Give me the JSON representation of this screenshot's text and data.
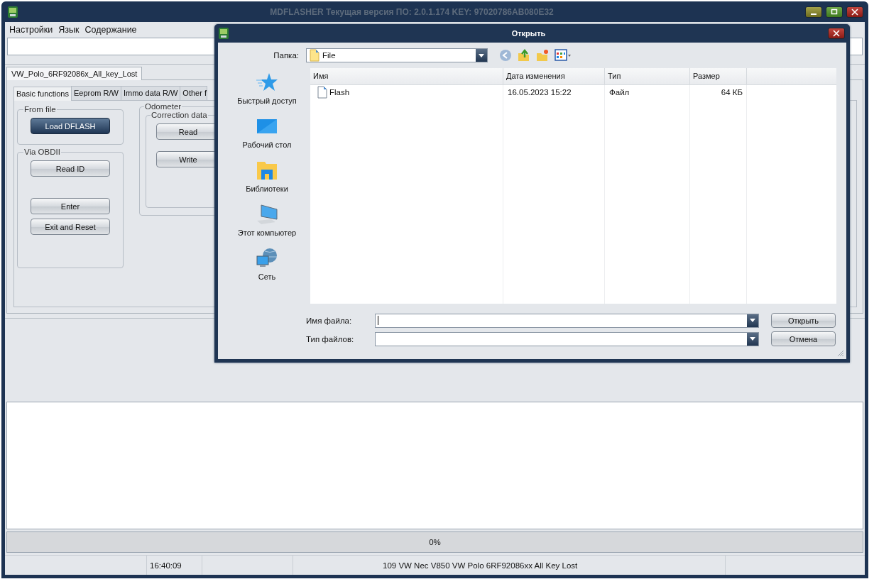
{
  "window": {
    "title": "MDFLASHER  Текущая версия ПО: 2.0.1.174  KEY: 97020786AB080E32"
  },
  "menu": [
    "Настройки",
    "Язык",
    "Содержание"
  ],
  "project_tabs": [
    {
      "label": "VW_Polo_6RF92086x_All_key_Lost",
      "selected": true
    }
  ],
  "function_tabs": [
    {
      "label": "Basic functions",
      "selected": true
    },
    {
      "label": "Eeprom R/W",
      "selected": false
    },
    {
      "label": "Immo data R/W",
      "selected": false
    },
    {
      "label": "Other f",
      "selected": false
    }
  ],
  "groups": {
    "from_file": {
      "title": "From file",
      "buttons": [
        {
          "label": "Load DFLASH",
          "kind": "primary"
        }
      ]
    },
    "via_obd": {
      "title": "Via OBDII",
      "buttons": [
        {
          "label": "Read ID",
          "kind": "normal"
        },
        {
          "label": "Enter",
          "kind": "normal"
        },
        {
          "label": "Exit and Reset",
          "kind": "normal"
        }
      ]
    },
    "odometer": {
      "title": "Odometer",
      "subgroup": "Correction data",
      "buttons": [
        {
          "label": "Read",
          "kind": "normal"
        },
        {
          "label": "Write",
          "kind": "normal"
        }
      ]
    }
  },
  "progress": {
    "level": 0,
    "reading": "0%"
  },
  "status_bar": {
    "time": "16:40:09",
    "message": "109 VW Nec V850 VW Polo 6RF92086xx All Key Lost"
  },
  "dialog": {
    "title": "Открыть",
    "folder_label": "Папка:",
    "folder": "File",
    "places": [
      {
        "label": "Быстрый доступ",
        "kind": "star"
      },
      {
        "label": "Рабочий стол",
        "kind": "desktop"
      },
      {
        "label": "Библиотеки",
        "kind": "library"
      },
      {
        "label": "Этот компьютер",
        "kind": "computer"
      },
      {
        "label": "Сеть",
        "kind": "network"
      }
    ],
    "columns": [
      "Имя",
      "Дата изменения",
      "Тип",
      "Размер"
    ],
    "rows": [
      {
        "name": "Flash",
        "date": "16.05.2023 15:22",
        "type": "Файл",
        "size": "64 КБ"
      }
    ],
    "filename_label": "Имя файла:",
    "filetype_label": "Тип файлов:",
    "buttons": [
      {
        "label": "Открыть"
      },
      {
        "label": "Отмена"
      }
    ]
  }
}
